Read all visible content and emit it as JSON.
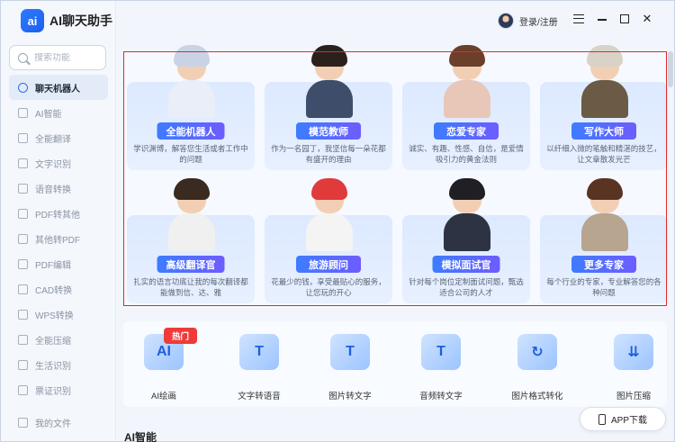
{
  "app": {
    "logo_text": "ai",
    "title": "AI聊天助手"
  },
  "search": {
    "placeholder": "搜索功能"
  },
  "sidebar": {
    "items": [
      {
        "label": "聊天机器人",
        "icon": "robot-icon",
        "active": true
      },
      {
        "label": "AI智能",
        "icon": "ai-icon"
      },
      {
        "label": "全能翻译",
        "icon": "translate-icon"
      },
      {
        "label": "文字识别",
        "icon": "ocr-icon"
      },
      {
        "label": "语音转换",
        "icon": "voice-icon"
      },
      {
        "label": "PDF转其他",
        "icon": "pdf-icon"
      },
      {
        "label": "其他转PDF",
        "icon": "to-pdf-icon"
      },
      {
        "label": "PDF编辑",
        "icon": "pdf-edit-icon"
      },
      {
        "label": "CAD转换",
        "icon": "cad-icon"
      },
      {
        "label": "WPS转换",
        "icon": "wps-icon"
      },
      {
        "label": "全能压缩",
        "icon": "compress-icon"
      },
      {
        "label": "生活识别",
        "icon": "scan-icon"
      },
      {
        "label": "票证识别",
        "icon": "ticket-icon"
      }
    ],
    "bottom": {
      "label": "我的文件",
      "icon": "folder-icon"
    }
  },
  "header": {
    "user_label": "登录/注册"
  },
  "cards": [
    {
      "tag": "全能机器人",
      "desc": "学识渊博，解答您生活或者工作中的问题",
      "hair": "#c9d3e6",
      "body": "#e9eef8"
    },
    {
      "tag": "模范教师",
      "desc": "作为一名园丁，我坚信每一朵花都有盛开的理由",
      "hair": "#2a211c",
      "body": "#3d4d6a"
    },
    {
      "tag": "恋爱专家",
      "desc": "诚实、有趣、性感、自信，是爱情吸引力的黄金法则",
      "hair": "#6b3f2a",
      "body": "#e8c7b8"
    },
    {
      "tag": "写作大师",
      "desc": "以纤细入微的笔触和精湛的技艺，让文章散发光芒",
      "hair": "#d8d2c8",
      "body": "#6a5a46"
    },
    {
      "tag": "高级翻译官",
      "desc": "扎实的语言功底让我的每次翻译都能做到信、达、雅",
      "hair": "#3a2a20",
      "body": "#f0f0f0"
    },
    {
      "tag": "旅游顾问",
      "desc": "花最少的钱，享受最贴心的服务，让您玩的开心",
      "hair": "#e03a3a",
      "body": "#f4f4f4"
    },
    {
      "tag": "模拟面试官",
      "desc": "针对每个岗位定制面试问题，甄选适合公司的人才",
      "hair": "#1f1f24",
      "body": "#2d3342"
    },
    {
      "tag": "更多专家",
      "desc": "每个行业的专家，专业解答您的各种问题",
      "hair": "#5a3422",
      "body": "#b8a590"
    }
  ],
  "hot_badge": "热门",
  "tools": [
    {
      "label": "AI绘画",
      "glyph": "AI",
      "icon": "ai-paint-icon"
    },
    {
      "label": "文字转语音",
      "glyph": "T",
      "icon": "text-to-speech-icon"
    },
    {
      "label": "图片转文字",
      "glyph": "T",
      "icon": "image-to-text-icon"
    },
    {
      "label": "音频转文字",
      "glyph": "T",
      "icon": "audio-to-text-icon"
    },
    {
      "label": "图片格式转化",
      "glyph": "↻",
      "icon": "image-convert-icon"
    },
    {
      "label": "图片压缩",
      "glyph": "⇊",
      "icon": "image-compress-icon"
    }
  ],
  "section_title": "AI智能",
  "app_download": "APP下载",
  "colors": {
    "accent": "#2b6ff0",
    "highlight_border": "#e02a2a",
    "hot": "#f03a3a"
  }
}
